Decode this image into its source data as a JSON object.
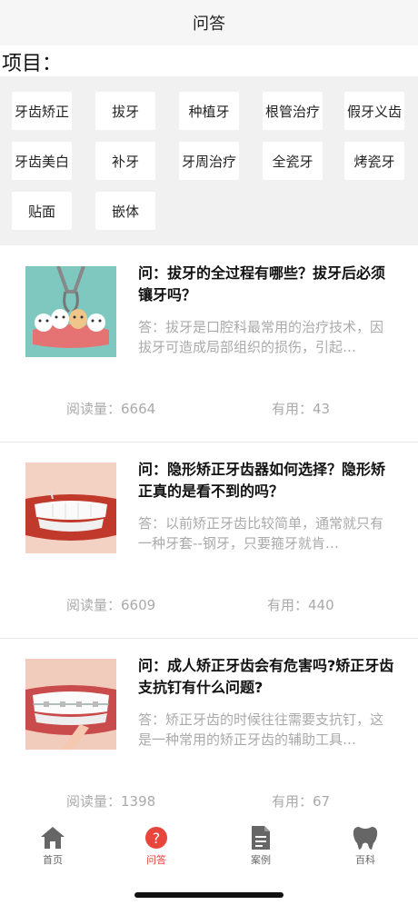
{
  "nav": {
    "title": "问答"
  },
  "section": {
    "label": "项目："
  },
  "tags": [
    "牙齿矫正",
    "拔牙",
    "种植牙",
    "根管治疗",
    "假牙义齿",
    "牙齿美白",
    "补牙",
    "牙周治疗",
    "全瓷牙",
    "烤瓷牙",
    "贴面",
    "嵌体"
  ],
  "articles": [
    {
      "question": "问：拔牙的全过程有哪些？拔牙后必须镶牙吗？",
      "answer": "答：拔牙是口腔科最常用的治疗技术，因拔牙可造成局部组织的损伤，引起…",
      "reads": "阅读量：6664",
      "useful": "有用：43"
    },
    {
      "question": "问：隐形矫正牙齿器如何选择？隐形矫正真的是看不到的吗？",
      "answer": "答：以前矫正牙齿比较简单，通常就只有一种牙套--钢牙，只要箍牙就肯…",
      "reads": "阅读量：6609",
      "useful": "有用：440"
    },
    {
      "question": "问：成人矫正牙齿会有危害吗?矫正牙齿支抗钉有什么问题?",
      "answer": "答：矫正牙齿的时候往往需要支抗钉，这是一种常用的矫正牙齿的辅助工具…",
      "reads": "阅读量：1398",
      "useful": "有用：67"
    }
  ],
  "tabbar": {
    "items": [
      {
        "label": "首页",
        "icon": "home-icon"
      },
      {
        "label": "问答",
        "icon": "question-icon"
      },
      {
        "label": "案例",
        "icon": "document-icon"
      },
      {
        "label": "百科",
        "icon": "tooth-icon"
      }
    ],
    "active_index": 1,
    "active_color": "#e8453c"
  }
}
